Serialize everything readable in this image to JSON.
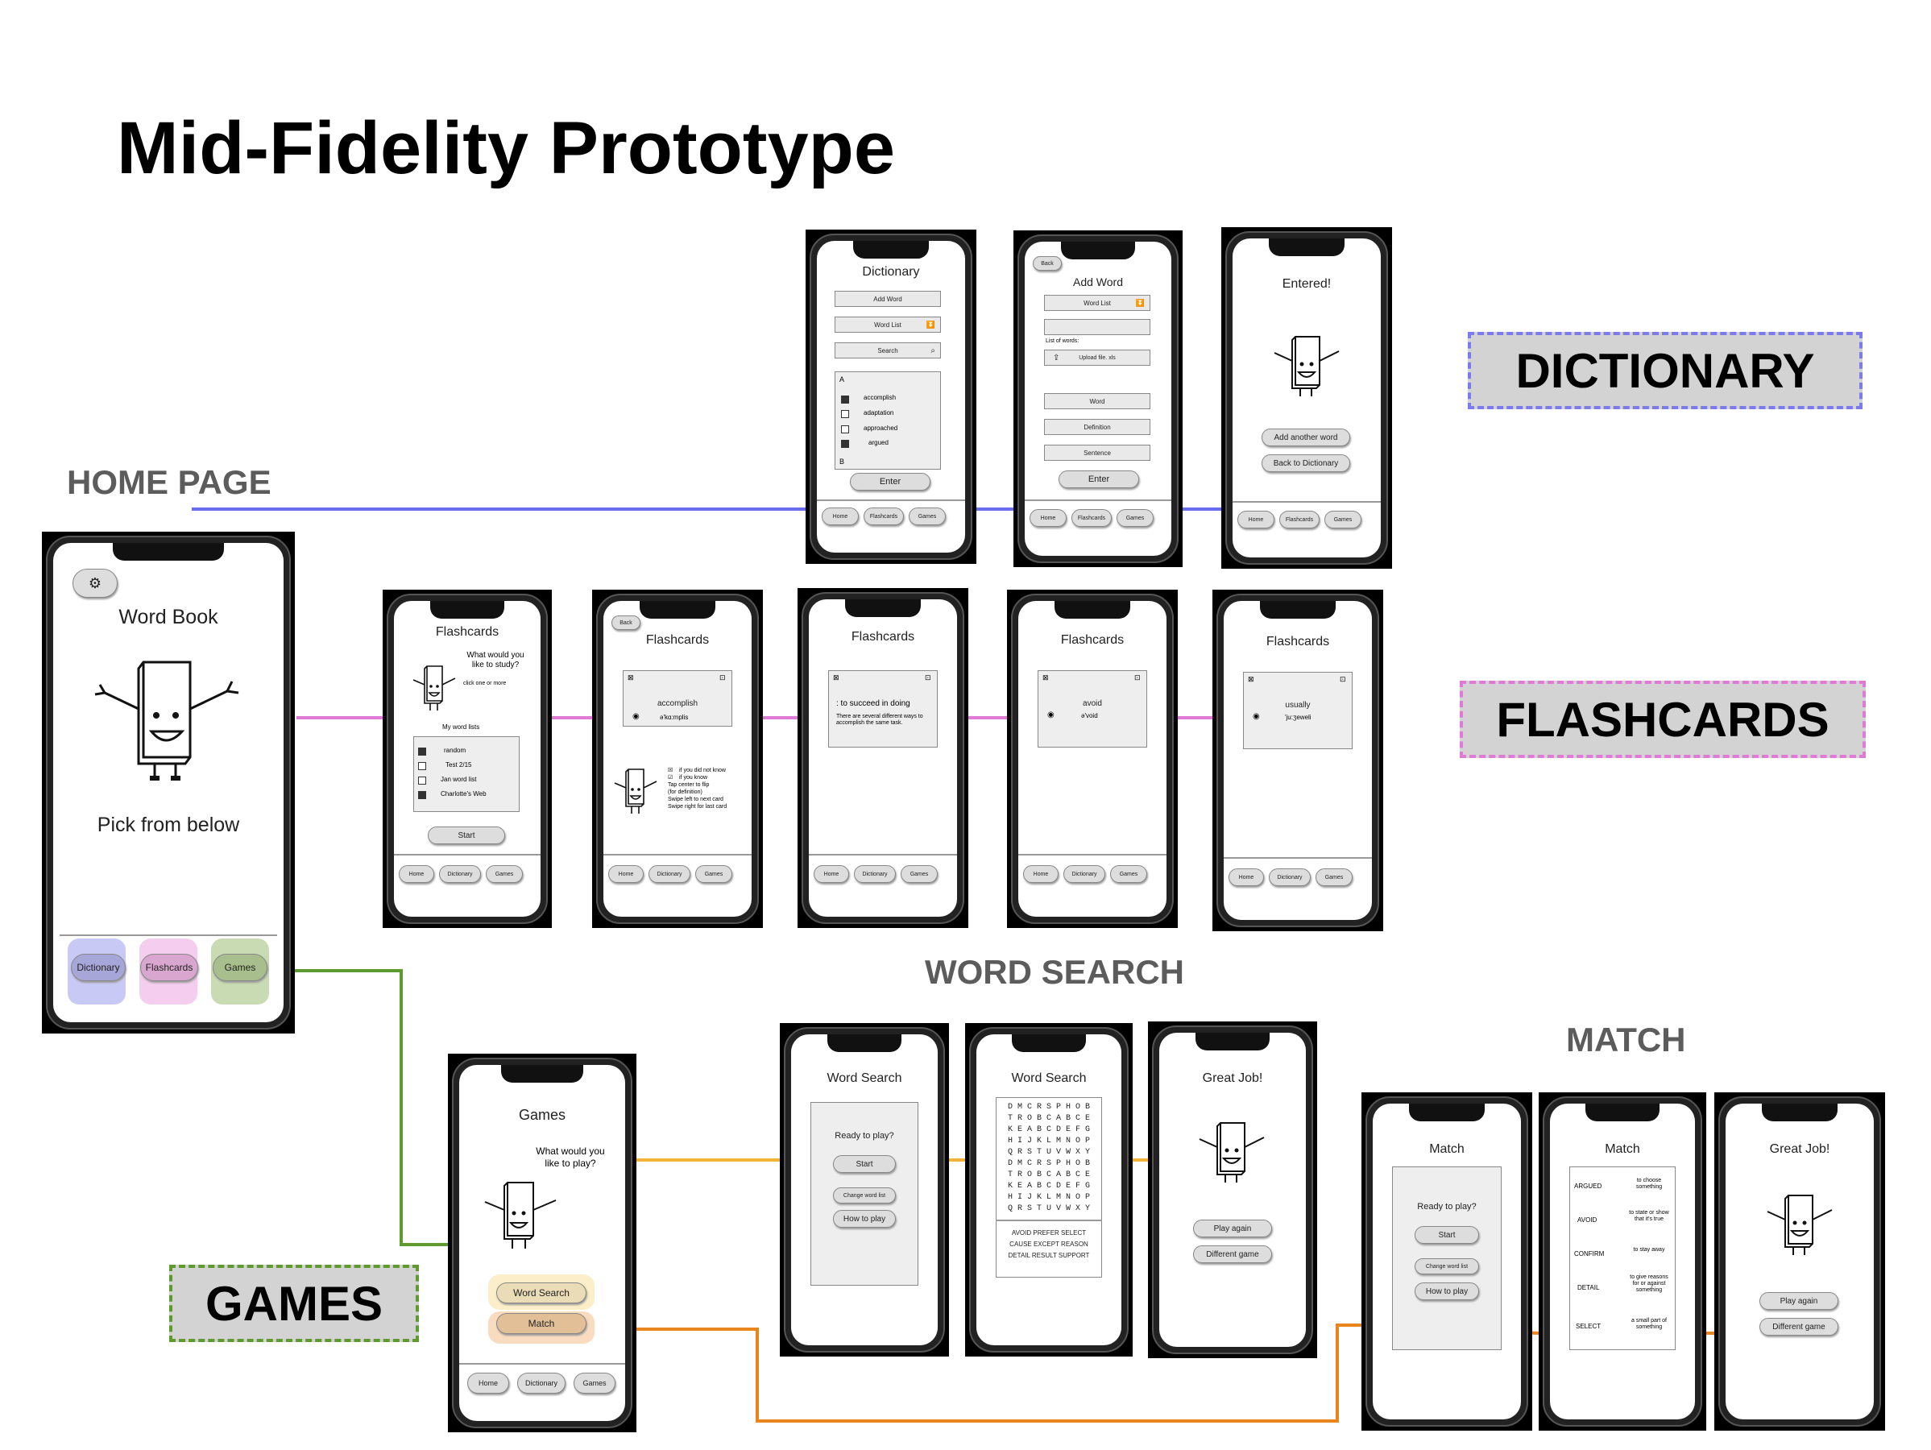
{
  "title": "Mid-Fidelity Prototype",
  "sections": {
    "home": "HOME PAGE",
    "word_search": "WORD SEARCH",
    "match": "MATCH"
  },
  "tags": {
    "dictionary": "DICTIONARY",
    "flashcards": "FLASHCARDS",
    "games": "GAMES"
  },
  "colors": {
    "dictionary": "#6b6bf0",
    "flashcards": "#e07ad6",
    "games": "#5e9a2e",
    "word_search": "#f2b437",
    "match": "#e8851d"
  },
  "nav": {
    "home": "Home",
    "dictionary": "Dictionary",
    "flashcards": "Flashcards",
    "games": "Games",
    "back": "Back"
  },
  "home": {
    "title": "Word Book",
    "subtitle": "Pick from below",
    "settings_icon": "gear-icon"
  },
  "dict1": {
    "title": "Dictionary",
    "add_word": "Add Word",
    "word_list": "Word List",
    "search": "Search",
    "letter_a": "A",
    "letter_b": "B",
    "words": [
      "accomplish",
      "adaptation",
      "approached",
      "argued"
    ],
    "checked": [
      true,
      false,
      false,
      true
    ],
    "enter": "Enter"
  },
  "dict2": {
    "title": "Add Word",
    "word_list": "Word List",
    "list_label": "List of words:",
    "upload": "Upload file. xls",
    "word": "Word",
    "definition": "Definition",
    "sentence": "Sentence",
    "enter": "Enter"
  },
  "dict3": {
    "title": "Entered!",
    "add_another": "Add another word",
    "back_to_dict": "Back to Dictionary"
  },
  "fc1": {
    "title": "Flashcards",
    "question": "What would you like to study?",
    "hint": "click one or more",
    "lists_label": "My word lists",
    "lists": [
      "random",
      "Test 2/15",
      "Jan word list",
      "Charlotte's Web"
    ],
    "checked": [
      true,
      false,
      false,
      true
    ],
    "start": "Start"
  },
  "fc2": {
    "title": "Flashcards",
    "word": "accomplish",
    "phonetic": "ə'kɑ:mplis",
    "legend_dont": "if you did not know",
    "legend_know": "if you know",
    "instructions": [
      "Tap center to flip",
      "(for definition)",
      "Swipe left to next card",
      "Swipe right for last card"
    ]
  },
  "fc3": {
    "title": "Flashcards",
    "definition": ": to succeed in doing",
    "example": "There are several different ways to accomplish the same task."
  },
  "fc4": {
    "title": "Flashcards",
    "word": "avoid",
    "phonetic": "ə'void"
  },
  "fc5": {
    "title": "Flashcards",
    "word": "usually",
    "phonetic": "'ju:ʒeweli"
  },
  "games": {
    "title": "Games",
    "question": "What would you like to play?",
    "word_search": "Word Search",
    "match": "Match"
  },
  "ws1": {
    "title": "Word Search",
    "ready": "Ready to play?",
    "start": "Start",
    "change_list": "Change word list",
    "how_to": "How to play"
  },
  "ws2": {
    "title": "Word Search",
    "grid": [
      "D M C R S P H O B",
      "T R O B C A B C E",
      "K E A B C D E F G",
      "H I J K L M N O P",
      "Q R S T U V W X Y",
      "D M C R S P H O B",
      "T R O B C A B C E",
      "K E A B C D E F G",
      "H I J K L M N O P",
      "Q R S T U V W X Y"
    ],
    "words": [
      "AVOID   PREFER   SELECT",
      "CAUSE   EXCEPT   REASON",
      "DETAIL   RESULT   SUPPORT"
    ]
  },
  "ws3": {
    "title": "Great Job!",
    "play_again": "Play again",
    "different": "Different game"
  },
  "m1": {
    "title": "Match",
    "ready": "Ready to play?",
    "start": "Start",
    "change_list": "Change word list",
    "how_to": "How to play"
  },
  "m2": {
    "title": "Match",
    "rows": [
      [
        "ARGUED",
        "to choose something"
      ],
      [
        "AVOID",
        "to state or show that it's true"
      ],
      [
        "CONFIRM",
        "to stay away"
      ],
      [
        "DETAIL",
        "to give reasons for or against something"
      ],
      [
        "SELECT",
        "a small part of something"
      ]
    ]
  },
  "m3": {
    "title": "Great Job!",
    "play_again": "Play again",
    "different": "Different game"
  }
}
